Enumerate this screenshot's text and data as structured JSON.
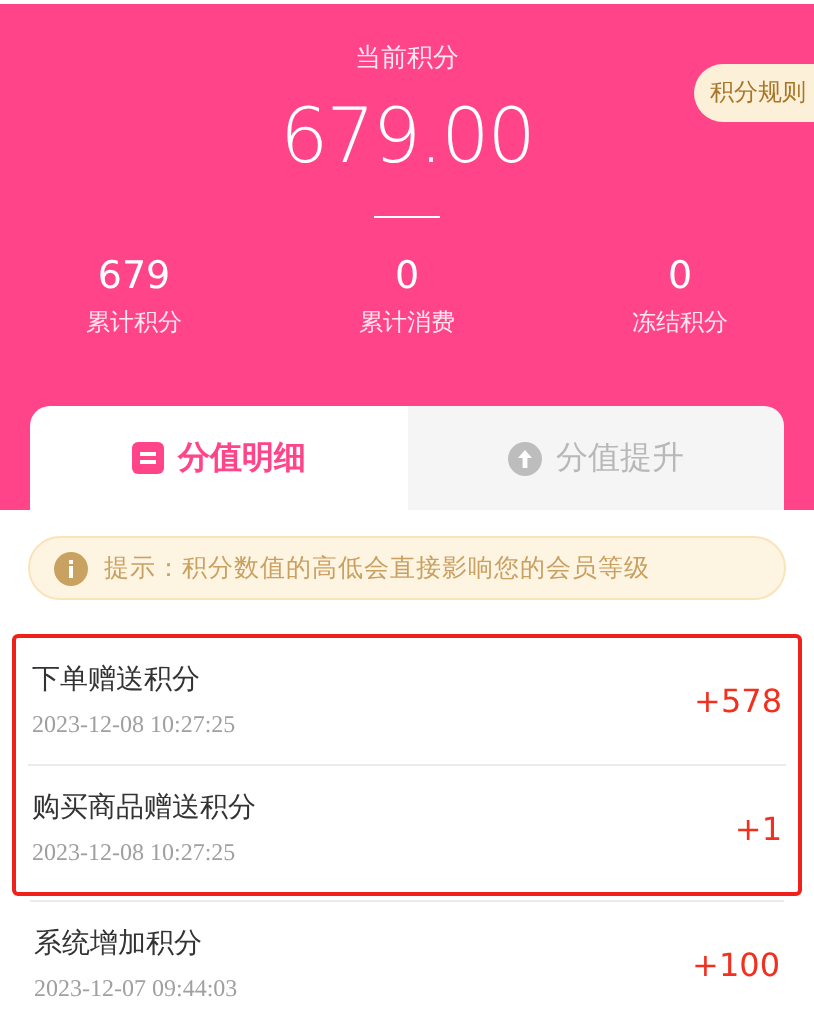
{
  "header": {
    "title": "当前积分",
    "balance": "679.00",
    "rules_button": "积分规则",
    "stats": [
      {
        "value": "679",
        "label": "累计积分"
      },
      {
        "value": "0",
        "label": "累计消费"
      },
      {
        "value": "0",
        "label": "冻结积分"
      }
    ]
  },
  "tabs": [
    {
      "label": "分值明细",
      "selected": true
    },
    {
      "label": "分值提升",
      "selected": false
    }
  ],
  "tip": "提示：积分数值的高低会直接影响您的会员等级",
  "records": [
    {
      "title": "下单赠送积分",
      "time": "2023-12-08 10:27:25",
      "amount": "+578",
      "highlighted": true
    },
    {
      "title": "购买商品赠送积分",
      "time": "2023-12-08 10:27:25",
      "amount": "+1",
      "highlighted": true
    },
    {
      "title": "系统增加积分",
      "time": "2023-12-07 09:44:03",
      "amount": "+100",
      "highlighted": false
    }
  ]
}
